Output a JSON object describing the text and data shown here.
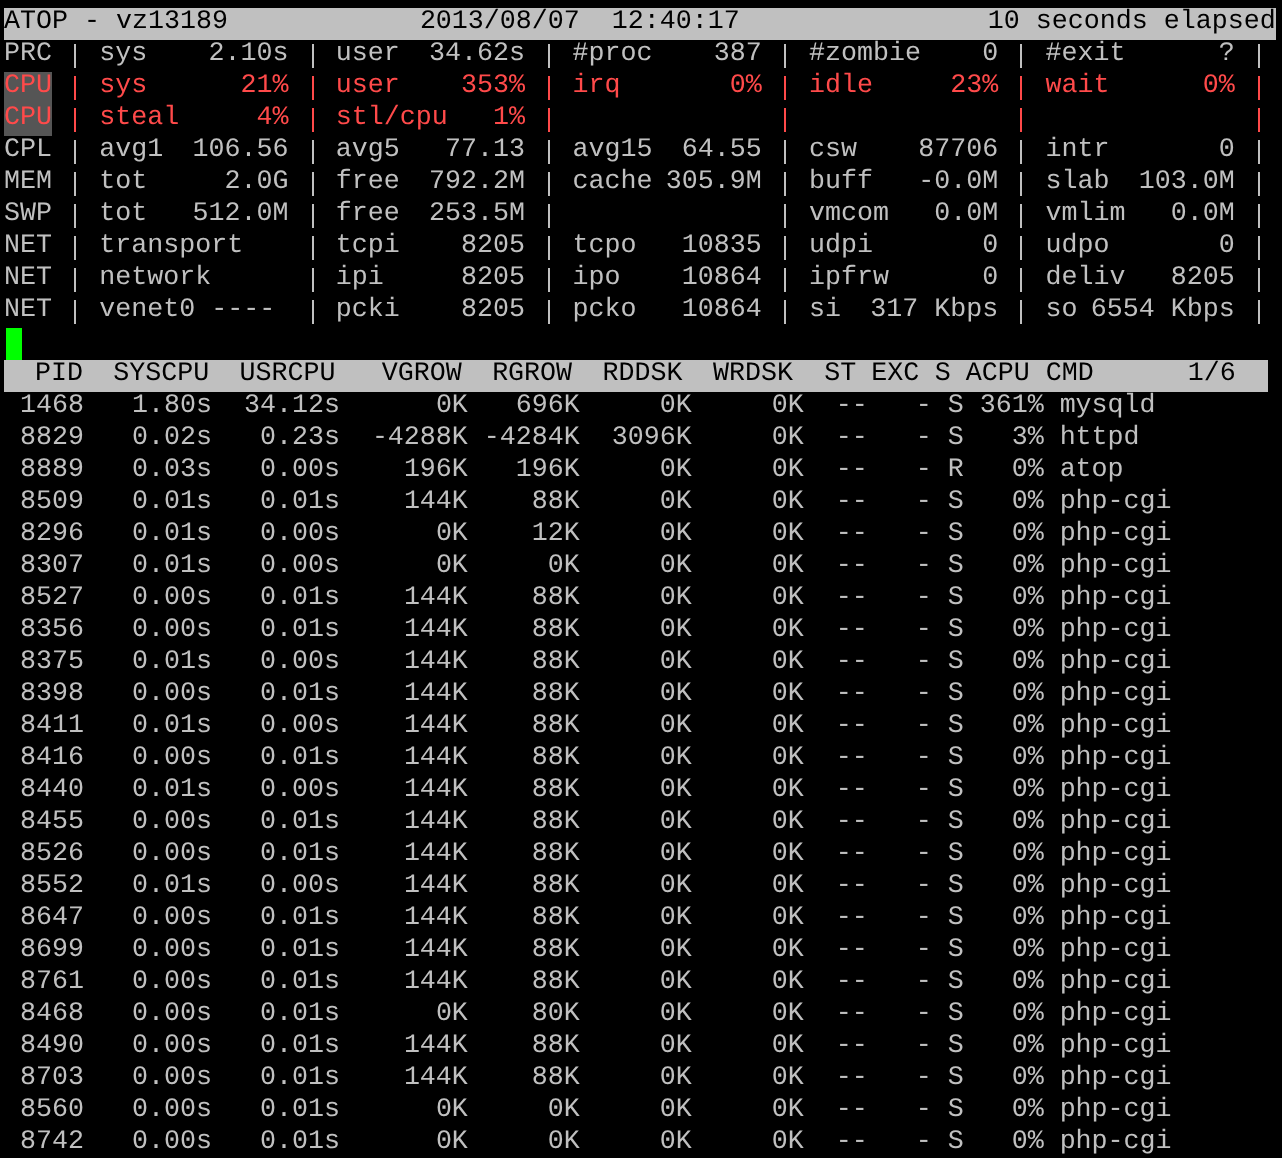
{
  "title_bar": {
    "host": "ATOP - vz13189",
    "date": "2013/08/07",
    "time": "12:40:17",
    "elapsed": "10 seconds elapsed"
  },
  "summary": [
    {
      "label": "PRC",
      "alert": false,
      "cells": [
        {
          "kind": "field",
          "label": "sys",
          "value": "2.10s"
        },
        {
          "kind": "field",
          "label": "user",
          "value": "34.62s"
        },
        {
          "kind": "field",
          "label": "#proc",
          "value": "387"
        },
        {
          "kind": "field",
          "label": "#zombie",
          "value": "0"
        },
        {
          "kind": "field",
          "label": "#exit",
          "value": "?"
        }
      ]
    },
    {
      "label": "CPU",
      "alert": true,
      "cells": [
        {
          "kind": "field",
          "label": "sys",
          "value": "21%"
        },
        {
          "kind": "field",
          "label": "user",
          "value": "353%"
        },
        {
          "kind": "field",
          "label": "irq",
          "value": "0%"
        },
        {
          "kind": "field",
          "label": "idle",
          "value": "23%"
        },
        {
          "kind": "field",
          "label": "wait",
          "value": "0%"
        }
      ]
    },
    {
      "label": "CPU",
      "alert": true,
      "cells": [
        {
          "kind": "field",
          "label": "steal",
          "value": "4%"
        },
        {
          "kind": "field",
          "label": "stl/cpu",
          "value": "1%"
        },
        {
          "kind": "empty"
        },
        {
          "kind": "empty"
        },
        {
          "kind": "empty"
        }
      ]
    },
    {
      "label": "CPL",
      "alert": false,
      "cells": [
        {
          "kind": "field",
          "label": "avg1",
          "value": "106.56"
        },
        {
          "kind": "field",
          "label": "avg5",
          "value": "77.13"
        },
        {
          "kind": "field",
          "label": "avg15",
          "value": "64.55"
        },
        {
          "kind": "field",
          "label": "csw",
          "value": "87706"
        },
        {
          "kind": "field",
          "label": "intr",
          "value": "0"
        }
      ]
    },
    {
      "label": "MEM",
      "alert": false,
      "cells": [
        {
          "kind": "field",
          "label": "tot",
          "value": "2.0G"
        },
        {
          "kind": "field",
          "label": "free",
          "value": "792.2M"
        },
        {
          "kind": "field",
          "label": "cache",
          "value": "305.9M"
        },
        {
          "kind": "field",
          "label": "buff",
          "value": "-0.0M"
        },
        {
          "kind": "field",
          "label": "slab",
          "value": "103.0M"
        }
      ]
    },
    {
      "label": "SWP",
      "alert": false,
      "cells": [
        {
          "kind": "field",
          "label": "tot",
          "value": "512.0M"
        },
        {
          "kind": "field",
          "label": "free",
          "value": "253.5M"
        },
        {
          "kind": "empty"
        },
        {
          "kind": "field",
          "label": "vmcom",
          "value": "0.0M"
        },
        {
          "kind": "field",
          "label": "vmlim",
          "value": "0.0M"
        }
      ]
    },
    {
      "label": "NET",
      "alert": false,
      "cells": [
        {
          "kind": "title",
          "label": "transport"
        },
        {
          "kind": "field",
          "label": "tcpi",
          "value": "8205"
        },
        {
          "kind": "field",
          "label": "tcpo",
          "value": "10835"
        },
        {
          "kind": "field",
          "label": "udpi",
          "value": "0"
        },
        {
          "kind": "field",
          "label": "udpo",
          "value": "0"
        }
      ]
    },
    {
      "label": "NET",
      "alert": false,
      "cells": [
        {
          "kind": "title",
          "label": "network"
        },
        {
          "kind": "field",
          "label": "ipi",
          "value": "8205"
        },
        {
          "kind": "field",
          "label": "ipo",
          "value": "10864"
        },
        {
          "kind": "field",
          "label": "ipfrw",
          "value": "0"
        },
        {
          "kind": "field",
          "label": "deliv",
          "value": "8205"
        }
      ]
    },
    {
      "label": "NET",
      "alert": false,
      "cells": [
        {
          "kind": "title",
          "label": "venet0 ----"
        },
        {
          "kind": "field",
          "label": "pcki",
          "value": "8205"
        },
        {
          "kind": "field",
          "label": "pcko",
          "value": "10864"
        },
        {
          "kind": "field",
          "label": "si",
          "value": "317 Kbps"
        },
        {
          "kind": "field",
          "label": "so",
          "value": "6554 Kbps"
        }
      ]
    }
  ],
  "process_table": {
    "columns": [
      "PID",
      "SYSCPU",
      "USRCPU",
      "VGROW",
      "RGROW",
      "RDDSK",
      "WRDSK",
      "ST",
      "EXC",
      "S",
      "ACPU",
      "CMD"
    ],
    "page": "1/6",
    "rows": [
      [
        "1468",
        "1.80s",
        "34.12s",
        "0K",
        "696K",
        "0K",
        "0K",
        "--",
        "-",
        "S",
        "361%",
        "mysqld"
      ],
      [
        "8829",
        "0.02s",
        "0.23s",
        "-4288K",
        "-4284K",
        "3096K",
        "0K",
        "--",
        "-",
        "S",
        "3%",
        "httpd"
      ],
      [
        "8889",
        "0.03s",
        "0.00s",
        "196K",
        "196K",
        "0K",
        "0K",
        "--",
        "-",
        "R",
        "0%",
        "atop"
      ],
      [
        "8509",
        "0.01s",
        "0.01s",
        "144K",
        "88K",
        "0K",
        "0K",
        "--",
        "-",
        "S",
        "0%",
        "php-cgi"
      ],
      [
        "8296",
        "0.01s",
        "0.00s",
        "0K",
        "12K",
        "0K",
        "0K",
        "--",
        "-",
        "S",
        "0%",
        "php-cgi"
      ],
      [
        "8307",
        "0.01s",
        "0.00s",
        "0K",
        "0K",
        "0K",
        "0K",
        "--",
        "-",
        "S",
        "0%",
        "php-cgi"
      ],
      [
        "8527",
        "0.00s",
        "0.01s",
        "144K",
        "88K",
        "0K",
        "0K",
        "--",
        "-",
        "S",
        "0%",
        "php-cgi"
      ],
      [
        "8356",
        "0.00s",
        "0.01s",
        "144K",
        "88K",
        "0K",
        "0K",
        "--",
        "-",
        "S",
        "0%",
        "php-cgi"
      ],
      [
        "8375",
        "0.01s",
        "0.00s",
        "144K",
        "88K",
        "0K",
        "0K",
        "--",
        "-",
        "S",
        "0%",
        "php-cgi"
      ],
      [
        "8398",
        "0.00s",
        "0.01s",
        "144K",
        "88K",
        "0K",
        "0K",
        "--",
        "-",
        "S",
        "0%",
        "php-cgi"
      ],
      [
        "8411",
        "0.01s",
        "0.00s",
        "144K",
        "88K",
        "0K",
        "0K",
        "--",
        "-",
        "S",
        "0%",
        "php-cgi"
      ],
      [
        "8416",
        "0.00s",
        "0.01s",
        "144K",
        "88K",
        "0K",
        "0K",
        "--",
        "-",
        "S",
        "0%",
        "php-cgi"
      ],
      [
        "8440",
        "0.01s",
        "0.00s",
        "144K",
        "88K",
        "0K",
        "0K",
        "--",
        "-",
        "S",
        "0%",
        "php-cgi"
      ],
      [
        "8455",
        "0.00s",
        "0.01s",
        "144K",
        "88K",
        "0K",
        "0K",
        "--",
        "-",
        "S",
        "0%",
        "php-cgi"
      ],
      [
        "8526",
        "0.00s",
        "0.01s",
        "144K",
        "88K",
        "0K",
        "0K",
        "--",
        "-",
        "S",
        "0%",
        "php-cgi"
      ],
      [
        "8552",
        "0.01s",
        "0.00s",
        "144K",
        "88K",
        "0K",
        "0K",
        "--",
        "-",
        "S",
        "0%",
        "php-cgi"
      ],
      [
        "8647",
        "0.00s",
        "0.01s",
        "144K",
        "88K",
        "0K",
        "0K",
        "--",
        "-",
        "S",
        "0%",
        "php-cgi"
      ],
      [
        "8699",
        "0.00s",
        "0.01s",
        "144K",
        "88K",
        "0K",
        "0K",
        "--",
        "-",
        "S",
        "0%",
        "php-cgi"
      ],
      [
        "8761",
        "0.00s",
        "0.01s",
        "144K",
        "88K",
        "0K",
        "0K",
        "--",
        "-",
        "S",
        "0%",
        "php-cgi"
      ],
      [
        "8468",
        "0.00s",
        "0.01s",
        "0K",
        "80K",
        "0K",
        "0K",
        "--",
        "-",
        "S",
        "0%",
        "php-cgi"
      ],
      [
        "8490",
        "0.00s",
        "0.01s",
        "144K",
        "88K",
        "0K",
        "0K",
        "--",
        "-",
        "S",
        "0%",
        "php-cgi"
      ],
      [
        "8703",
        "0.00s",
        "0.01s",
        "144K",
        "88K",
        "0K",
        "0K",
        "--",
        "-",
        "S",
        "0%",
        "php-cgi"
      ],
      [
        "8560",
        "0.00s",
        "0.01s",
        "0K",
        "0K",
        "0K",
        "0K",
        "--",
        "-",
        "S",
        "0%",
        "php-cgi"
      ],
      [
        "8742",
        "0.00s",
        "0.01s",
        "0K",
        "0K",
        "0K",
        "0K",
        "--",
        "-",
        "S",
        "0%",
        "php-cgi"
      ]
    ]
  }
}
